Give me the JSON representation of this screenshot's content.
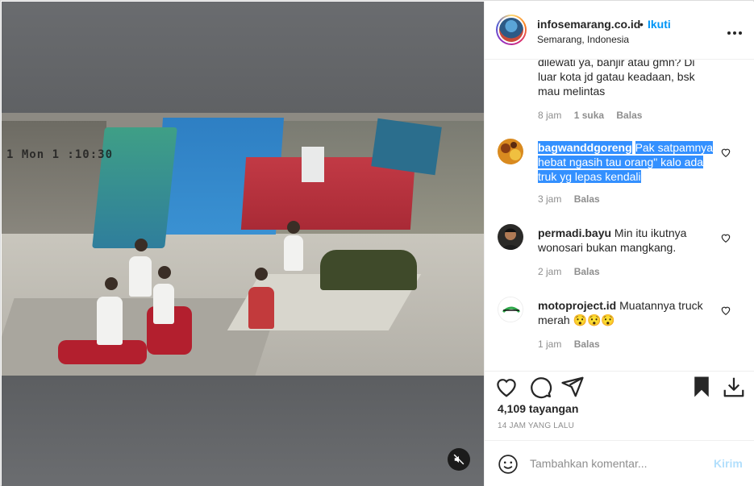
{
  "post": {
    "timestamp_overlay": "1 Mon 1 :10:30"
  },
  "header": {
    "username": "infosemarang.co.id",
    "separator": "•",
    "follow_label": "Ikuti",
    "location": "Semarang, Indonesia",
    "more_label": "•••"
  },
  "partial_comment": {
    "text": "dilewati ya, banjir atau gmn? Di luar kota jd gatau keadaan, bsk mau melintas",
    "time": "8 jam",
    "likes": "1 suka",
    "reply": "Balas"
  },
  "comments": [
    {
      "username": "bagwanddgoreng",
      "text": "Pak satpamnya hebat ngasih tau orang\" kalo ada truk yg lepas kendali",
      "time": "3 jam",
      "reply": "Balas"
    },
    {
      "username": "permadi.bayu",
      "text": "Min itu ikutnya wonosari bukan mangkang.",
      "time": "2 jam",
      "reply": "Balas"
    },
    {
      "username": "motoproject.id",
      "text": "Muatannya truck merah 😯😯😯",
      "time": "1 jam",
      "reply": "Balas"
    }
  ],
  "stats": {
    "views": "4,109 tayangan",
    "posted": "14 JAM YANG LALU"
  },
  "add_comment": {
    "placeholder": "Tambahkan komentar...",
    "post_label": "Kirim"
  },
  "colors": {
    "accent": "#0095f6",
    "highlight": "#3390ff",
    "post_disabled": "#b2dffc",
    "muted_text": "#8e8e8e"
  }
}
